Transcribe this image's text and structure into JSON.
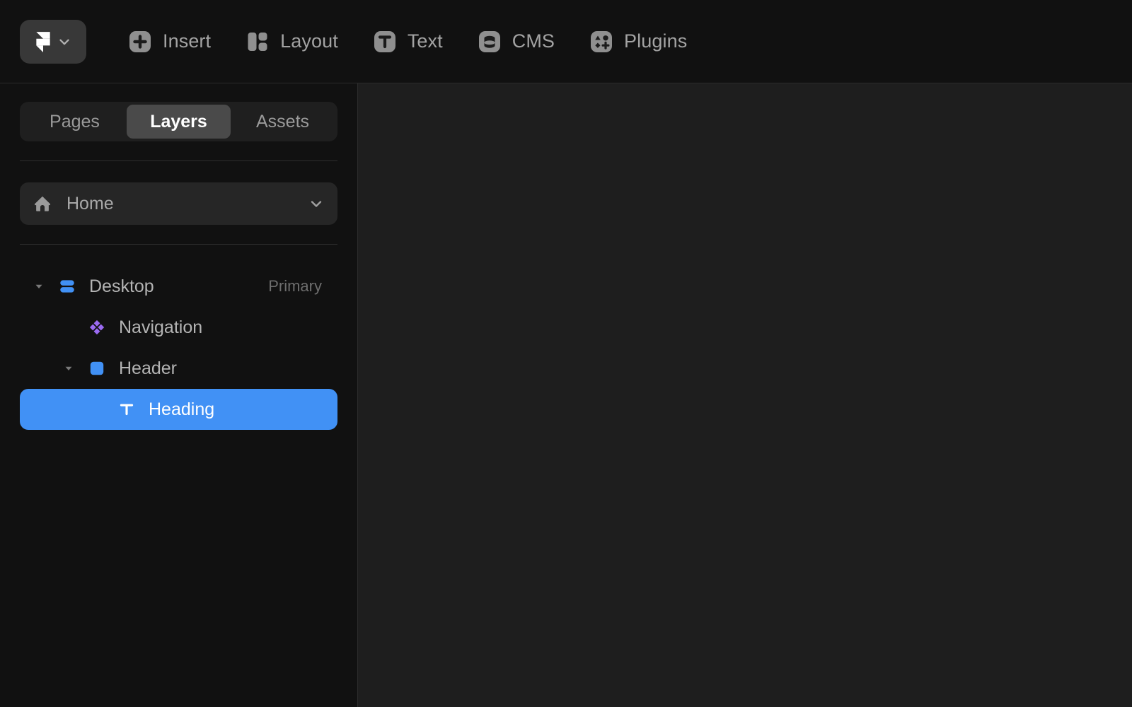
{
  "app": {
    "name": "Framer",
    "accent_color": "#4191f5",
    "sidebar_bg": "#111111",
    "canvas_bg": "#1e1e1e"
  },
  "topbar": {
    "logo": {
      "icon": "framer-logo-icon",
      "chevron": "chevron-down-icon"
    },
    "items": [
      {
        "label": "Insert",
        "icon": "plus-square-icon"
      },
      {
        "label": "Layout",
        "icon": "layout-panels-icon"
      },
      {
        "label": "Text",
        "icon": "text-t-icon"
      },
      {
        "label": "CMS",
        "icon": "database-icon"
      },
      {
        "label": "Plugins",
        "icon": "plugins-shapes-icon"
      }
    ]
  },
  "sidebar": {
    "tabs": [
      {
        "label": "Pages",
        "active": false
      },
      {
        "label": "Layers",
        "active": true
      },
      {
        "label": "Assets",
        "active": false
      }
    ],
    "page_selector": {
      "icon": "home-icon",
      "label": "Home",
      "chevron": "chevron-down-icon"
    },
    "layers": [
      {
        "label": "Desktop",
        "badge": "Primary",
        "icon": "breakpoint-icon",
        "icon_color": "#4191f5",
        "depth": 0,
        "expanded": true,
        "has_disclosure": true,
        "selected": false
      },
      {
        "label": "Navigation",
        "badge": "",
        "icon": "component-icon",
        "icon_color": "#9b6bf2",
        "depth": 1,
        "expanded": false,
        "has_disclosure": false,
        "selected": false
      },
      {
        "label": "Header",
        "badge": "",
        "icon": "frame-icon",
        "icon_color": "#4191f5",
        "depth": 1,
        "expanded": true,
        "has_disclosure": true,
        "selected": false
      },
      {
        "label": "Heading",
        "badge": "",
        "icon": "text-layer-icon",
        "icon_color": "#ffffff",
        "depth": 2,
        "expanded": false,
        "has_disclosure": false,
        "selected": true
      }
    ]
  }
}
